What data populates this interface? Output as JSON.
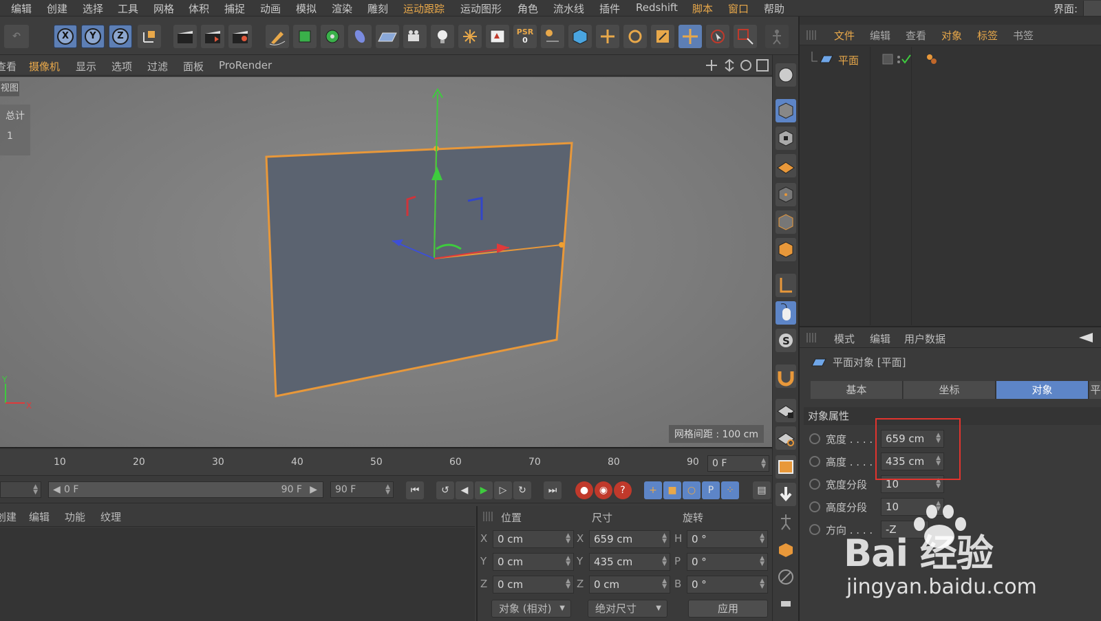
{
  "menubar": {
    "items": [
      "编辑",
      "创建",
      "选择",
      "工具",
      "网格",
      "体积",
      "捕捉",
      "动画",
      "模拟",
      "渲染",
      "雕刻",
      "运动跟踪",
      "运动图形",
      "角色",
      "流水线",
      "插件",
      "Redshift",
      "脚本",
      "窗口",
      "帮助"
    ],
    "layout_label": "界面:"
  },
  "toolbar": {
    "axis_x": "X",
    "axis_y": "Y",
    "axis_z": "Z",
    "psr_label": "PSR",
    "psr_value": "0"
  },
  "viewport_menu": {
    "items": [
      "查看",
      "摄像机",
      "显示",
      "选项",
      "过滤",
      "面板",
      "ProRender"
    ]
  },
  "viewport": {
    "view_name": "视图",
    "hud_label": "总计",
    "hud_value": "1",
    "grid_spacing": "网格间距 : 100 cm",
    "axis_y": "Y",
    "axis_x": "X"
  },
  "object_manager": {
    "menu": [
      "文件",
      "编辑",
      "查看",
      "对象",
      "标签",
      "书签"
    ],
    "object_name": "平面"
  },
  "attribute_manager": {
    "menu": [
      "模式",
      "编辑",
      "用户数据"
    ],
    "title": "平面对象 [平面]",
    "tabs": [
      "基本",
      "坐标",
      "对象",
      "平"
    ],
    "active_tab": "对象",
    "section": "对象属性",
    "props": [
      {
        "label": "宽度 . . . .",
        "value": "659 cm"
      },
      {
        "label": "高度 . . . .",
        "value": "435 cm"
      },
      {
        "label": "宽度分段",
        "value": "10"
      },
      {
        "label": "高度分段",
        "value": "10"
      },
      {
        "label": "方向 . . . .",
        "value": "-Z"
      }
    ]
  },
  "timeline": {
    "ticks": [
      "10",
      "20",
      "30",
      "40",
      "50",
      "60",
      "70",
      "80",
      "90"
    ],
    "current_frame": "0 F",
    "range_start": "0 F",
    "range_end": "90 F",
    "max_frame": "90 F"
  },
  "material_manager": {
    "menu": [
      "创建",
      "编辑",
      "功能",
      "纹理"
    ]
  },
  "coordinates": {
    "headers": [
      "位置",
      "尺寸",
      "旋转"
    ],
    "rows": [
      {
        "pos_axis": "X",
        "pos": "0 cm",
        "size_axis": "X",
        "size": "659 cm",
        "rot_axis": "H",
        "rot": "0 °"
      },
      {
        "pos_axis": "Y",
        "pos": "0 cm",
        "size_axis": "Y",
        "size": "435 cm",
        "rot_axis": "P",
        "rot": "0 °"
      },
      {
        "pos_axis": "Z",
        "pos": "0 cm",
        "size_axis": "Z",
        "size": "0 cm",
        "rot_axis": "B",
        "rot": "0 °"
      }
    ],
    "mode_dropdown": "对象 (相对)",
    "size_dropdown": "绝对尺寸",
    "apply_label": "应用"
  },
  "watermark": {
    "main": "Bai 经验",
    "sub": "jingyan.baidu.com"
  },
  "colors": {
    "accent_orange": "#e8a84a",
    "selection_blue": "#5d85c7",
    "highlight_red": "#e2342e",
    "plane_fill": "#5b6370",
    "axis_x": "#e03a3a",
    "axis_y": "#3ecb3e",
    "axis_z": "#3d4fd6"
  }
}
